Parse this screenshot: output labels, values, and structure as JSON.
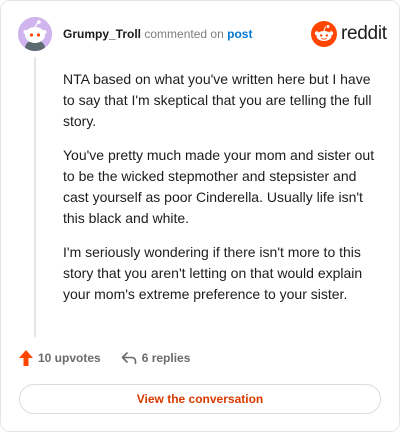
{
  "comment": {
    "author": "Grumpy_Troll",
    "action_text": "commented on",
    "target_link": "post",
    "paragraphs": [
      "NTA based on what you've written here but I have to say that I'm skeptical that you are telling the full story.",
      "You've pretty much made your mom and sister out to be the wicked stepmother and stepsister and cast yourself as poor Cinderella. Usually life isn't this black and white.",
      "I'm seriously wondering if there isn't more to this story that you aren't letting on that would explain your mom's extreme preference to your sister."
    ]
  },
  "brand": {
    "name": "reddit",
    "icon": "reddit-snoo-icon",
    "color": "#ff4500"
  },
  "stats": {
    "upvotes_label": "10 upvotes",
    "replies_label": "6 replies"
  },
  "cta": {
    "label": "View the conversation",
    "color": "#d93a00"
  },
  "colors": {
    "avatar_bg": "#cfb4ee",
    "link": "#0079d3",
    "upvote": "#ff4500"
  }
}
